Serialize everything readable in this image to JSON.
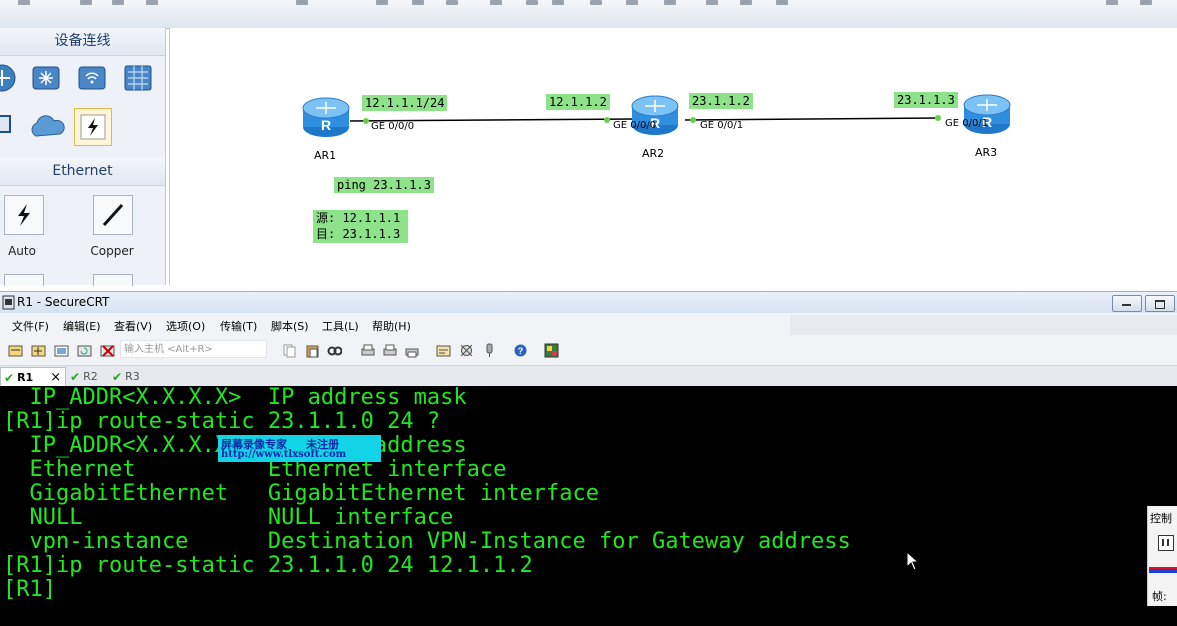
{
  "left_panel": {
    "header_devices": "设备连线",
    "header_ethernet": "Ethernet",
    "cables": [
      {
        "label": "Auto",
        "icon": "auto-cable-icon"
      },
      {
        "label": "Copper",
        "icon": "copper-cable-icon"
      }
    ]
  },
  "topology": {
    "routers": [
      {
        "name": "AR1"
      },
      {
        "name": "AR2"
      },
      {
        "name": "AR3"
      }
    ],
    "labels": {
      "ar1_ip": "12.1.1.1/24",
      "ar2_left_ip": "12.1.1.2",
      "ar2_right_ip": "23.1.1.2",
      "ar3_ip": "23.1.1.3",
      "ping": "ping 23.1.1.3",
      "src": "源: 12.1.1.1",
      "dst": "目: 23.1.1.3"
    },
    "ports": {
      "ar1_port": "GE 0/0/0",
      "ar2_port_left": "GE 0/0/0",
      "ar2_port_right": "GE 0/0/1",
      "ar3_port": "GE 0/0/1"
    },
    "label_color": "#8ee38a"
  },
  "crt": {
    "title": "R1 - SecureCRT",
    "menu": [
      "文件(F)",
      "编辑(E)",
      "查看(V)",
      "选项(O)",
      "传输(T)",
      "脚本(S)",
      "工具(L)",
      "帮助(H)"
    ],
    "host_placeholder": "输入主机 <Alt+R>",
    "tabs": [
      "R1",
      "R2",
      "R3"
    ],
    "tab_close": "×",
    "terminal_lines": [
      "  IP_ADDR<X.X.X.X>  IP address mask",
      "[R1]ip route-static 23.1.1.0 24 ?",
      "  IP_ADDR<X.X.X.X>  Gateway address",
      "  Ethernet          Ethernet interface",
      "  GigabitEthernet   GigabitEthernet interface",
      "  NULL              NULL interface",
      "  vpn-instance      Destination VPN-Instance for Gateway address",
      "[R1]ip route-static 23.1.1.0 24 12.1.1.2",
      "[R1]"
    ],
    "terminal_color": "#22e622"
  },
  "watermark": {
    "title": "屏幕录像专家     未注册",
    "url": "http://www.tlxsoft.com"
  },
  "control_panel": {
    "label": "控制",
    "frame_label": "帧:"
  }
}
